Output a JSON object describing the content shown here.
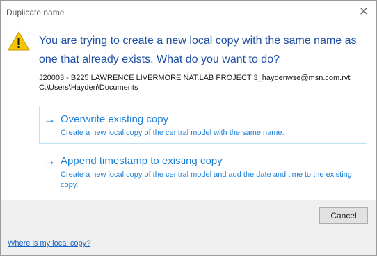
{
  "window": {
    "title": "Duplicate name",
    "close_icon": "close-icon"
  },
  "main_instruction": "You are trying to create a new local copy with the same name as one that already exists. What do you want to do?",
  "content": {
    "filename": "J20003 - B225 LAWRENCE LIVERMORE NAT.LAB PROJECT 3_haydenwse@msn.com.rvt",
    "path": "C:\\Users\\Hayden\\Documents"
  },
  "commands": [
    {
      "title": "Overwrite existing copy",
      "description": "Create a new local copy of the central model with the same name."
    },
    {
      "title": "Append timestamp to existing copy",
      "description": "Create a new local copy of the central model and add the date and time to the existing copy."
    }
  ],
  "buttons": {
    "cancel": "Cancel"
  },
  "footer": {
    "link": "Where is my local copy?"
  },
  "colors": {
    "accent": "#1c7fd6",
    "instruction": "#1e4fa5",
    "warning": "#f6c700"
  },
  "icons": {
    "warning": "warning-icon",
    "arrow": "arrow-right-icon"
  }
}
